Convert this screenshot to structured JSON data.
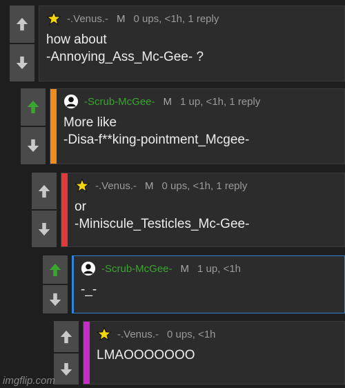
{
  "colors": {
    "background": "#1e1e1e",
    "card": "#2c2c2c",
    "upvote_active": "#3aa52f",
    "vote_inactive": "#c9c9c9",
    "stripe_orange": "#f08c1e",
    "stripe_red": "#e23a3a",
    "stripe_blue": "#2f86d8",
    "stripe_magenta": "#c92bc9"
  },
  "comments": [
    {
      "username": "-.Venus.-",
      "flag": "M",
      "stats": "0 ups, <1h, 1 reply",
      "text": "how about\n-Annoying_Ass_Mc-Gee- ?",
      "avatar": "star-icon",
      "upvoted": false
    },
    {
      "username": "-Scrub-McGee-",
      "flag": "M",
      "stats": "1 up, <1h, 1 reply",
      "text": "More like\n-Disa-f**king-pointment_Mcgee-",
      "avatar": "user-silhouette-icon",
      "upvoted": true
    },
    {
      "username": "-.Venus.-",
      "flag": "M",
      "stats": "0 ups, <1h, 1 reply",
      "text": "or\n-Miniscule_Testicles_Mc-Gee-",
      "avatar": "star-icon",
      "upvoted": false
    },
    {
      "username": "-Scrub-McGee-",
      "flag": "M",
      "stats": "1 up, <1h",
      "text": "-_-",
      "avatar": "user-silhouette-icon",
      "upvoted": true
    },
    {
      "username": "-.Venus.-",
      "flag": "",
      "stats": "0 ups, <1h",
      "text": "LMAOOOOOOO",
      "avatar": "star-icon",
      "upvoted": false
    }
  ],
  "watermark": "imgflip.com"
}
